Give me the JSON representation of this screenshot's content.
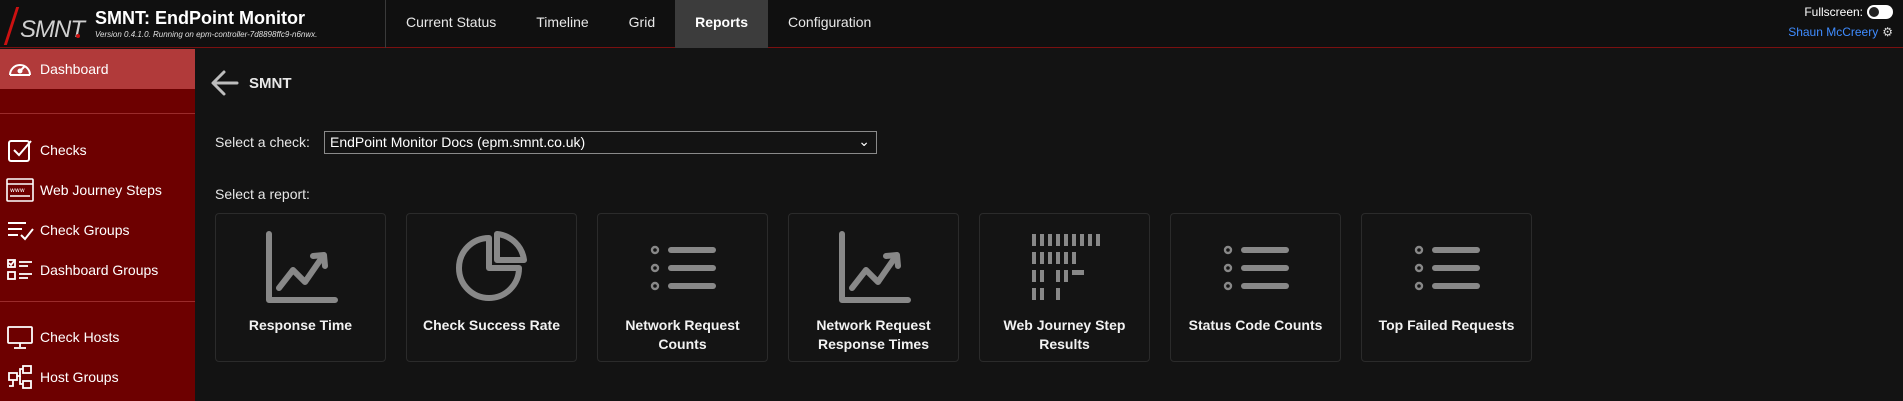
{
  "header": {
    "logo_text": "SMNT",
    "app_title": "SMNT: EndPoint Monitor",
    "version_text": "Version 0.4.1.0. Running on epm-controller-7d8898ffc9-n6nwx.",
    "fullscreen_label": "Fullscreen:",
    "user_name": "Shaun McCreery",
    "nav": [
      {
        "label": "Current Status",
        "active": false
      },
      {
        "label": "Timeline",
        "active": false
      },
      {
        "label": "Grid",
        "active": false
      },
      {
        "label": "Reports",
        "active": true
      },
      {
        "label": "Configuration",
        "active": false
      }
    ]
  },
  "sidebar": {
    "items": [
      {
        "label": "Dashboard",
        "icon": "gauge-icon",
        "active": true
      },
      {
        "label": "Checks",
        "icon": "checkbox-icon"
      },
      {
        "label": "Web Journey Steps",
        "icon": "browser-icon"
      },
      {
        "label": "Check Groups",
        "icon": "list-check-icon"
      },
      {
        "label": "Dashboard Groups",
        "icon": "checklist-icon"
      },
      {
        "label": "Check Hosts",
        "icon": "monitor-icon"
      },
      {
        "label": "Host Groups",
        "icon": "network-icon"
      }
    ]
  },
  "main": {
    "breadcrumb": "SMNT",
    "check_label": "Select a check:",
    "check_value": "EndPoint Monitor Docs (epm.smnt.co.uk)",
    "report_label": "Select a report:",
    "reports": [
      {
        "label": "Response Time",
        "icon": "line-chart-icon"
      },
      {
        "label": "Check Success Rate",
        "icon": "pie-chart-icon"
      },
      {
        "label": "Network Request Counts",
        "icon": "list-icon"
      },
      {
        "label": "Network Request Response Times",
        "icon": "line-chart-icon"
      },
      {
        "label": "Web Journey Step Results",
        "icon": "waterfall-icon"
      },
      {
        "label": "Status Code Counts",
        "icon": "list-icon"
      },
      {
        "label": "Top Failed Requests",
        "icon": "list-icon"
      }
    ]
  },
  "colors": {
    "sidebar_bg": "#6d0000",
    "sidebar_active": "#b13a3a",
    "accent": "#cc1111",
    "user_link": "#3f8cff"
  }
}
